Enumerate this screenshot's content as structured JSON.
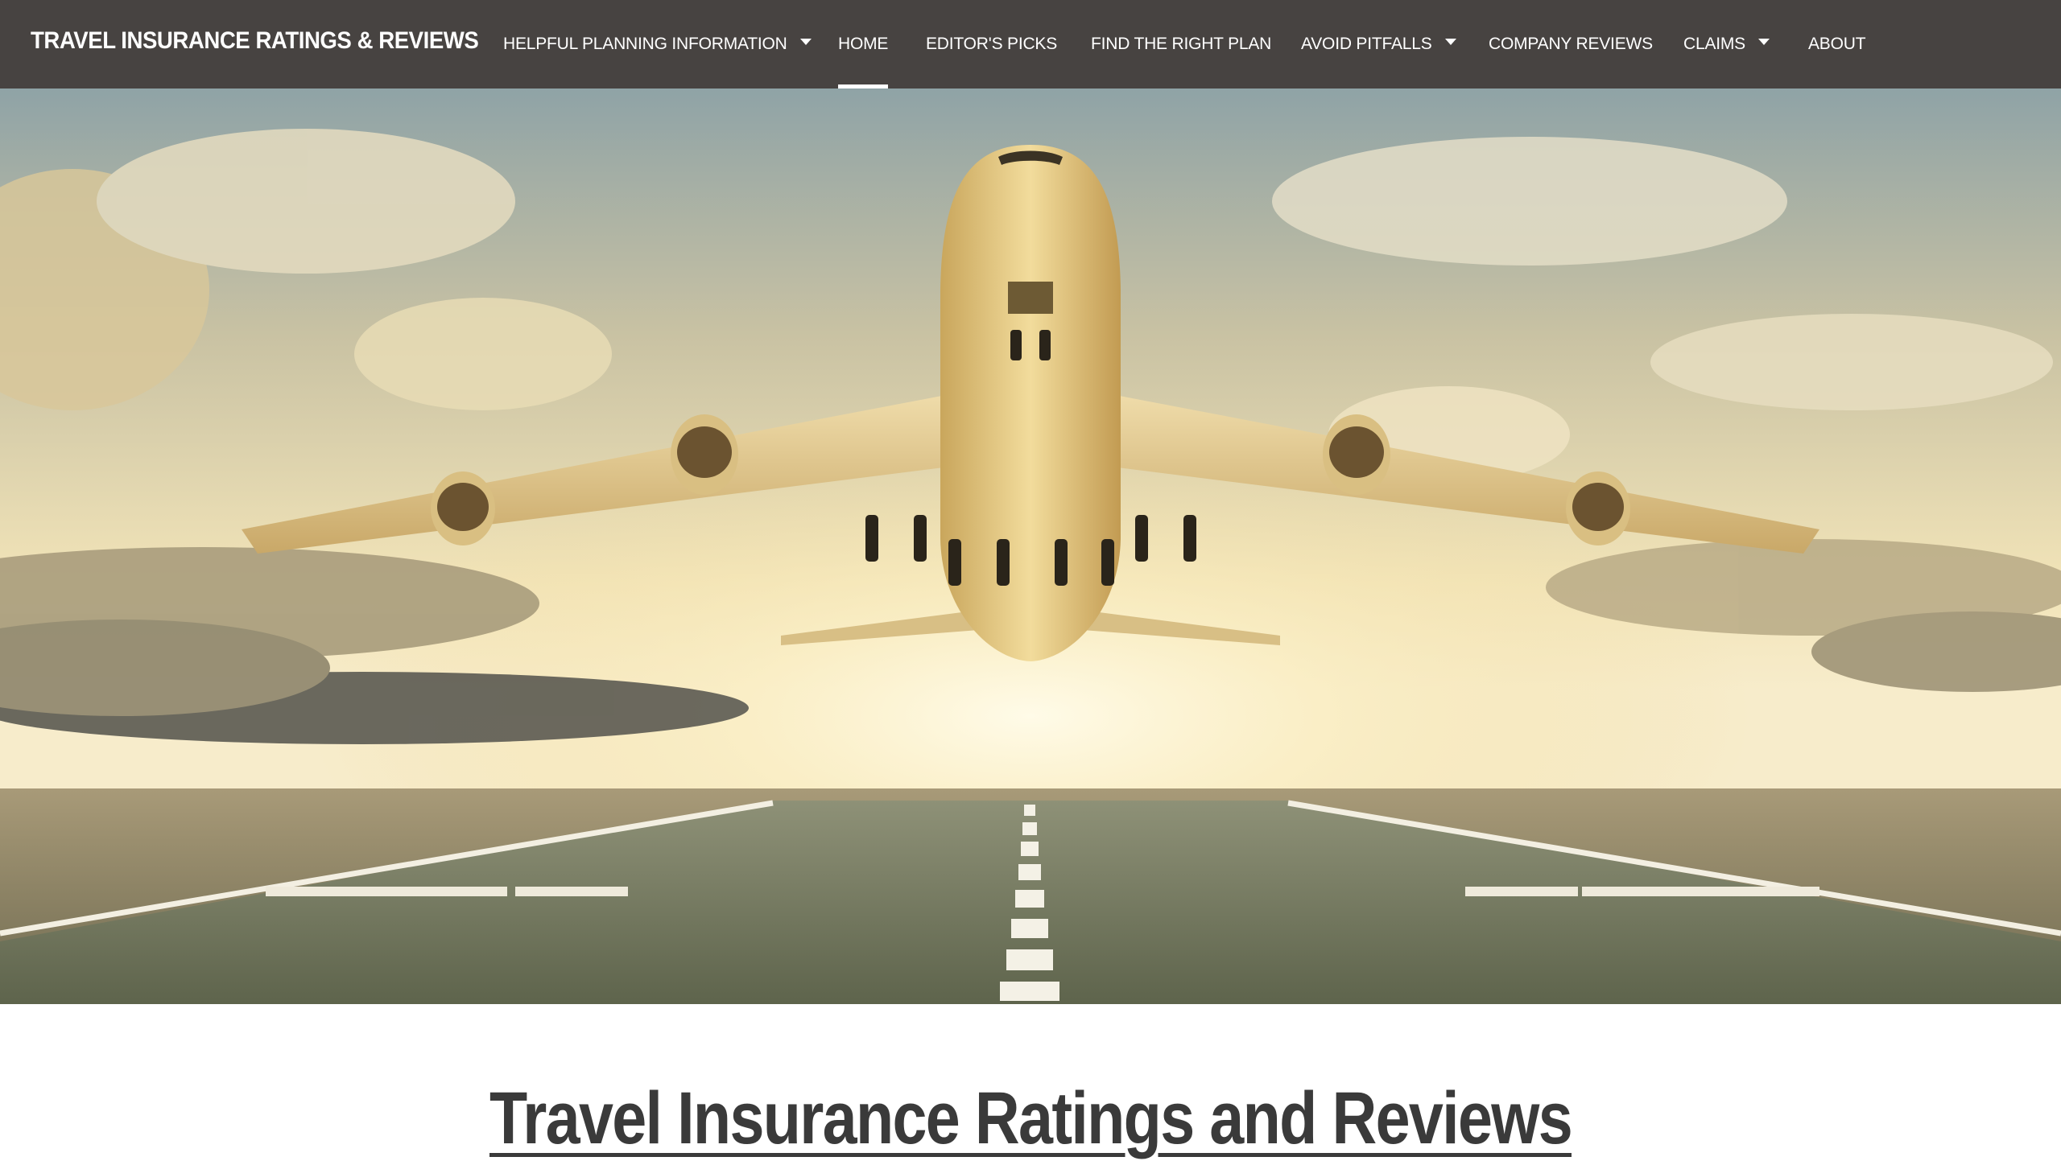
{
  "header": {
    "site_title": "TRAVEL INSURANCE RATINGS & REVIEWS"
  },
  "nav": {
    "items": [
      {
        "label": "HELPFUL PLANNING INFORMATION",
        "dropdown": true,
        "active": false
      },
      {
        "label": "HOME",
        "dropdown": false,
        "active": true
      },
      {
        "label": "EDITOR'S PICKS",
        "dropdown": false,
        "active": false
      },
      {
        "label": "FIND THE RIGHT PLAN",
        "dropdown": false,
        "active": false
      },
      {
        "label": "AVOID PITFALLS",
        "dropdown": true,
        "active": false
      },
      {
        "label": "COMPANY REVIEWS",
        "dropdown": false,
        "active": false
      },
      {
        "label": "CLAIMS",
        "dropdown": true,
        "active": false
      },
      {
        "label": "ABOUT",
        "dropdown": false,
        "active": false
      }
    ]
  },
  "main": {
    "headline": "Travel Insurance Ratings and Reviews"
  },
  "colors": {
    "navbar_bg": "#474341",
    "nav_text": "#ffffff",
    "headline_text": "#3a3a3a"
  }
}
